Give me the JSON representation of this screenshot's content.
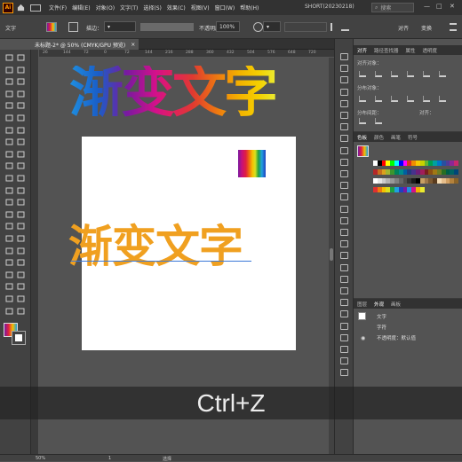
{
  "app": {
    "logo": "Ai",
    "window_title": "SHORT(20230218)",
    "search_placeholder": "搜索"
  },
  "menu": [
    "文件(F)",
    "编辑(E)",
    "对象(O)",
    "文字(T)",
    "选择(S)",
    "效果(C)",
    "视图(V)",
    "窗口(W)",
    "帮助(H)"
  ],
  "control_bar": {
    "object_type": "文字",
    "stroke_label": "描边：",
    "opacity_label": "不透明度：",
    "opacity_value": "100%",
    "align_label": "对齐",
    "transform_label": "变换",
    "style_label": "样式"
  },
  "document_tab": {
    "title": "未标题-2* @ 50% (CMYK/GPU 预览)",
    "close": "×"
  },
  "ruler_ticks": [
    "26",
    "144",
    "72",
    "0",
    "72",
    "144",
    "216",
    "288",
    "360",
    "432",
    "504",
    "576",
    "648",
    "720"
  ],
  "canvas": {
    "gradient_title": "渐变文字",
    "orange_text": "渐变文字",
    "orange_color": "#f0a020"
  },
  "panels": {
    "top_tabs": [
      "对齐",
      "路径查找器",
      "属性",
      "透明度"
    ],
    "align_objects_label": "对齐对象：",
    "distribute_objects_label": "分布对象：",
    "distribute_spacing_label": "分布间距：",
    "align_to_label": "对齐：",
    "swatch_tabs": [
      "色板",
      "颜色",
      "画笔",
      "符号"
    ],
    "appearance_tabs": [
      "图层",
      "外观",
      "画板"
    ],
    "appearance_title": "文字",
    "appearance_char": "字符",
    "appearance_opacity": "不透明度：默认值"
  },
  "status_bar": {
    "zoom": "50%",
    "page": "1",
    "tool_name": "选择"
  },
  "overlay_caption": "Ctrl+Z",
  "colors": {
    "menu_bg": "#323232",
    "panel_bg": "#424242",
    "canvas_bg": "#535353",
    "accent_orange": "#ff9a00"
  }
}
